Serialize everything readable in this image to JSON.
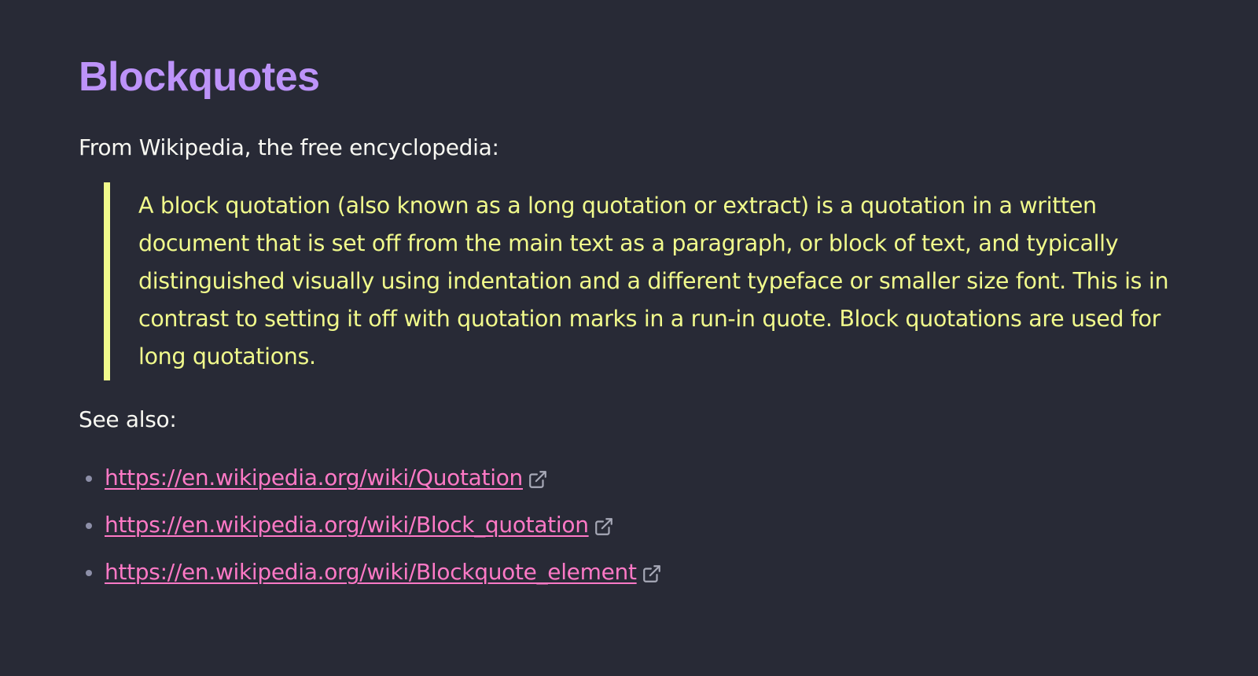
{
  "title": "Blockquotes",
  "intro": "From Wikipedia, the free encyclopedia:",
  "blockquote": "A block quotation (also known as a long quotation or extract) is a quotation in a written document that is set off from the main text as a paragraph, or block of text, and typically distinguished visually using indentation and a different typeface or smaller size font. This is in contrast to setting it off with quotation marks in a run-in quote. Block quotations are used for long quotations.",
  "see_also": "See also:",
  "links": [
    {
      "text": "https://en.wikipedia.org/wiki/Quotation",
      "icon": "external-link-icon"
    },
    {
      "text": "https://en.wikipedia.org/wiki/Block_quotation",
      "icon": "external-link-icon"
    },
    {
      "text": "https://en.wikipedia.org/wiki/Blockquote_element",
      "icon": "external-link-icon"
    }
  ],
  "colors": {
    "background": "#282a36",
    "title": "#bd93f9",
    "text": "#f8f8f2",
    "quote": "#f1fa8c",
    "link": "#ff79c6",
    "bullet": "#8d8fa8"
  }
}
